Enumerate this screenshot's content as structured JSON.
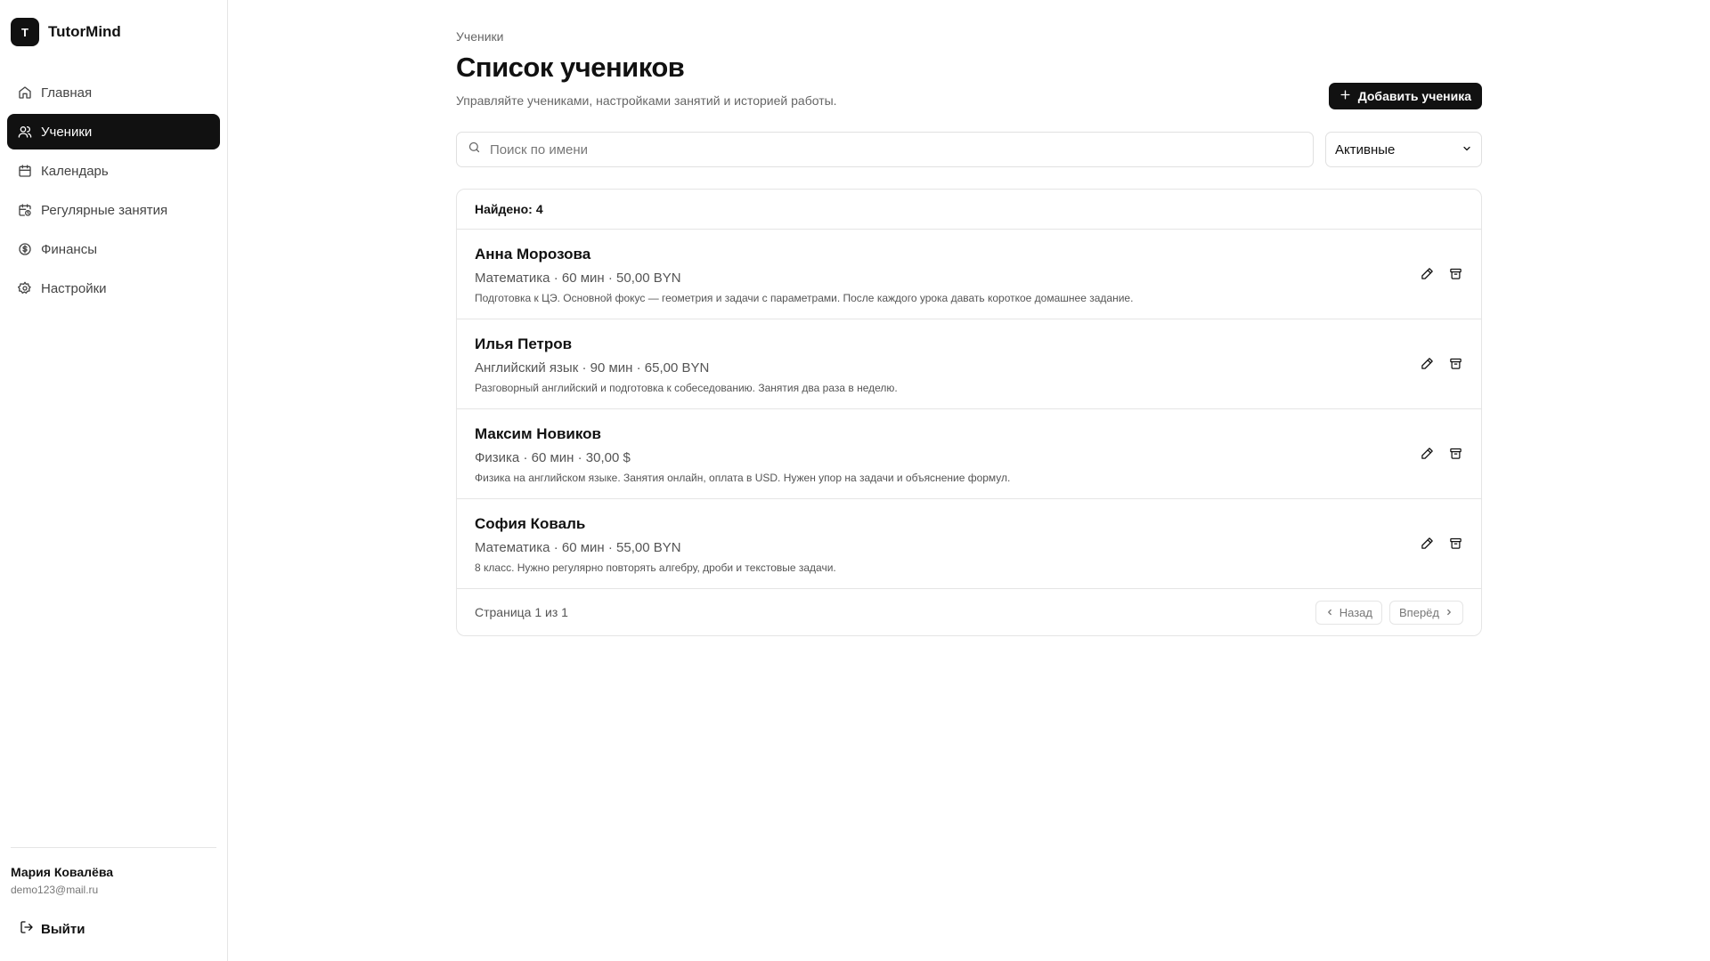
{
  "app": {
    "logo_letter": "T",
    "name": "TutorMind"
  },
  "sidebar": {
    "items": [
      {
        "label": "Главная",
        "icon": "home-icon"
      },
      {
        "label": "Ученики",
        "icon": "users-icon",
        "active": true
      },
      {
        "label": "Календарь",
        "icon": "calendar-icon"
      },
      {
        "label": "Регулярные занятия",
        "icon": "calendar-repeat-icon"
      },
      {
        "label": "Финансы",
        "icon": "currency-icon"
      },
      {
        "label": "Настройки",
        "icon": "gear-icon"
      }
    ],
    "user": {
      "name": "Мария Ковалёва",
      "email": "demo123@mail.ru"
    },
    "logout_label": "Выйти"
  },
  "header": {
    "breadcrumb": "Ученики",
    "title": "Список учеников",
    "subtitle": "Управляйте учениками, настройками занятий и историей работы.",
    "add_button_label": "Добавить ученика"
  },
  "search": {
    "placeholder": "Поиск по имени",
    "value": ""
  },
  "filter": {
    "selected": "Активные"
  },
  "list": {
    "found_label": "Найдено:",
    "found_count": "4",
    "students": [
      {
        "name": "Анна Морозова",
        "meta": "Математика · 60 мин · 50,00 BYN",
        "note": "Подготовка к ЦЭ. Основной фокус — геометрия и задачи с параметрами. После каждого урока давать короткое домашнее задание."
      },
      {
        "name": "Илья Петров",
        "meta": "Английский язык · 90 мин · 65,00 BYN",
        "note": "Разговорный английский и подготовка к собеседованию. Занятия два раза в неделю."
      },
      {
        "name": "Максим Новиков",
        "meta": "Физика · 60 мин · 30,00 $",
        "note": "Физика на английском языке. Занятия онлайн, оплата в USD. Нужен упор на задачи и объяснение формул."
      },
      {
        "name": "София Коваль",
        "meta": "Математика · 60 мин · 55,00 BYN",
        "note": "8 класс. Нужно регулярно повторять алгебру, дроби и текстовые задачи."
      }
    ]
  },
  "pagination": {
    "info": "Страница 1 из 1",
    "prev_label": "Назад",
    "next_label": "Вперёд"
  },
  "colors": {
    "accent": "#111111",
    "border": "#e5e5e5",
    "muted_text": "#666666"
  }
}
